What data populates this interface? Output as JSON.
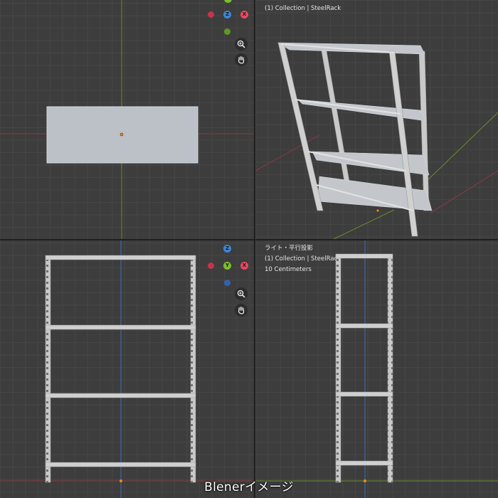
{
  "viewports": {
    "top_right": {
      "line2": "(1) Collection | SteelRack"
    },
    "bottom_right": {
      "line1": "ライト・平行投影",
      "line2": "(1) Collection | SteelRack",
      "line3": "10 Centimeters"
    }
  },
  "gizmo_top": {
    "z": "Z",
    "x": "X",
    "y": "Y"
  },
  "gizmo_bottom": {
    "z": "Z",
    "y": "Y",
    "x": "X"
  },
  "colors": {
    "x_axis": "#e84a5f",
    "y_axis": "#7bbf2a",
    "z_axis": "#3e84d6",
    "rack_face": "#bcc1c7",
    "frame_gray": "#c6c6c6",
    "origin": "#f08a1a"
  },
  "icons": [
    "zoom-icon",
    "hand-icon"
  ],
  "caption": "Blenerイメージ"
}
